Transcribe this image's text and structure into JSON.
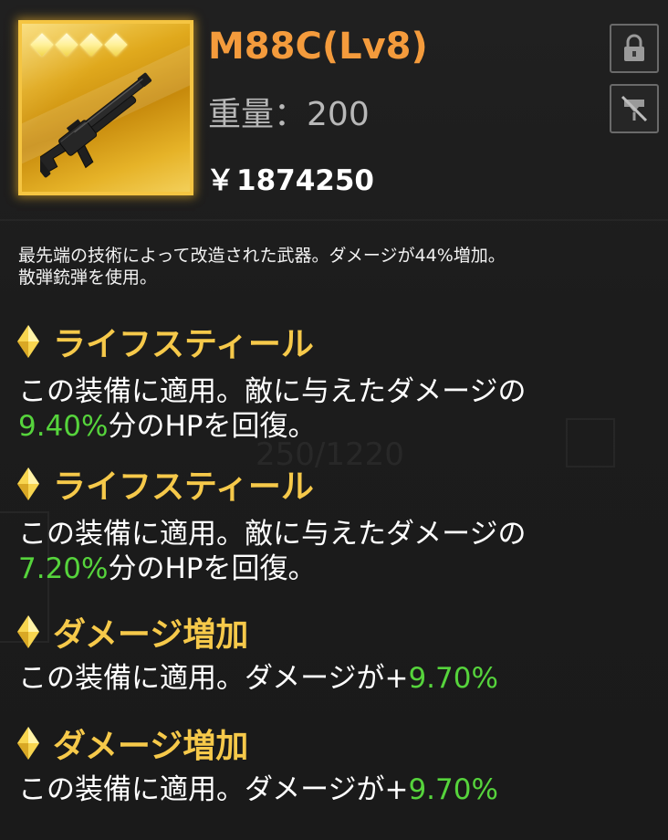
{
  "item": {
    "name": "M88C(Lv8)",
    "weight_label": "重量：",
    "weight_value": "200",
    "price_symbol": "￥",
    "price_value": "1874250",
    "rarity_stars": 4,
    "icon": "shotgun-icon"
  },
  "buttons": {
    "lock_icon": "lock-icon",
    "unequip_icon": "flag-off-icon"
  },
  "description": {
    "line1": "最先端の技術によって改造された武器。ダメージが44%増加。",
    "line2": "散弾銃弾を使用。"
  },
  "effects": [
    {
      "title": "ライフスティール",
      "line1": "この装備に適用。敵に与えたダメージの",
      "value": "9.40%",
      "line2_suffix": "分のHPを回復。"
    },
    {
      "title": "ライフスティール",
      "line1": "この装備に適用。敵に与えたダメージの",
      "value": "7.20%",
      "line2_suffix": "分のHPを回復。"
    },
    {
      "title": "ダメージ増加",
      "prefix": "この装備に適用。ダメージが+",
      "value": "9.70%"
    },
    {
      "title": "ダメージ増加",
      "prefix": "この装備に適用。ダメージが+",
      "value": "9.70%"
    }
  ],
  "colors": {
    "item_name": "#f49b3c",
    "effect_title": "#f6c94a",
    "value_green": "#56d43c",
    "frame_gold": "#f5c542"
  }
}
